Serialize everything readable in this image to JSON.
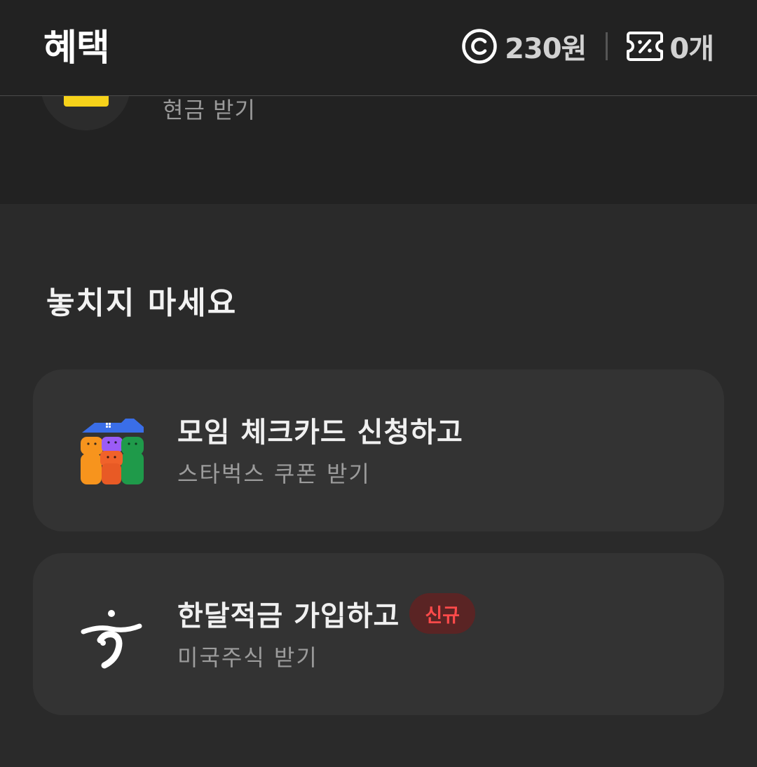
{
  "header": {
    "title": "혜택",
    "points": "230원",
    "coupons": "0개"
  },
  "top_item": {
    "subtitle": "현금 받기"
  },
  "section": {
    "title": "놓치지 마세요"
  },
  "cards": [
    {
      "title": "모임 체크카드 신청하고",
      "subtitle": "스타벅스 쿠폰 받기",
      "icon": "moim-card-icon"
    },
    {
      "title": "한달적금 가입하고",
      "subtitle": "미국주식 받기",
      "badge": "신규",
      "icon": "hana-bank-logo-icon"
    }
  ],
  "colors": {
    "background": "#2a2a2a",
    "header_bg": "#222222",
    "card_bg": "#333333",
    "badge_text": "#ff4a4a",
    "badge_bg": "#5a2424",
    "accent_yellow": "#f6d21a"
  }
}
